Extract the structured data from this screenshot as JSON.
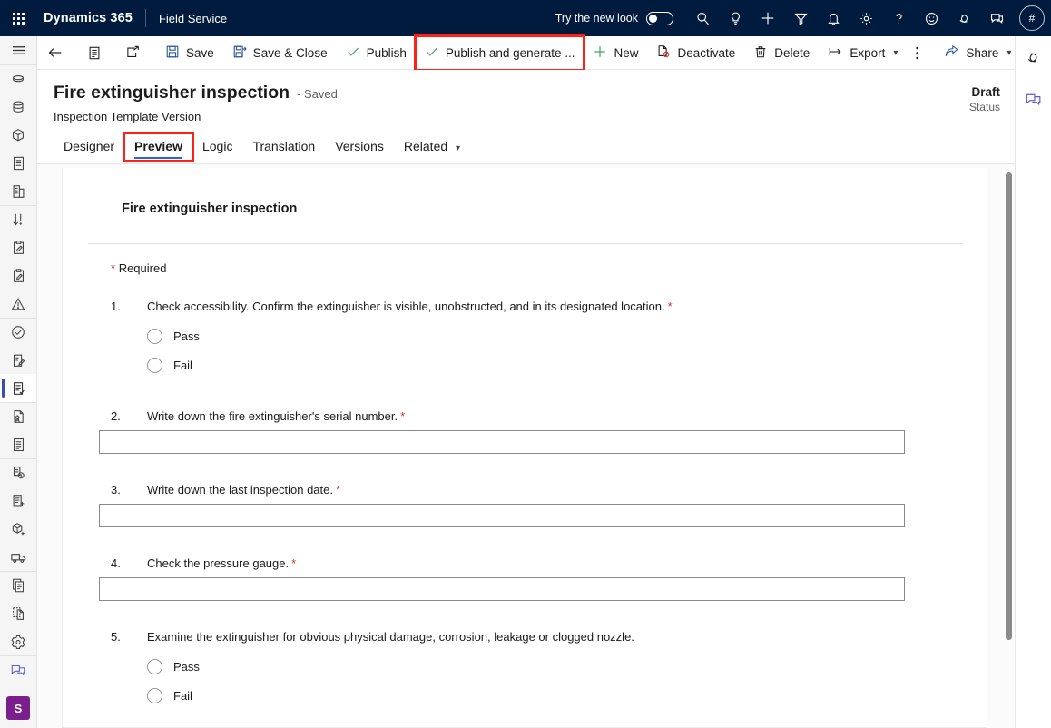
{
  "suite": {
    "waffle_label": "app-launcher",
    "brand": "Dynamics 365",
    "app_name": "Field Service",
    "new_look_label": "Try the new look",
    "new_look_on": false,
    "icons": [
      {
        "name": "search-icon",
        "label": "Search"
      },
      {
        "name": "lightbulb-icon",
        "label": "Insights"
      },
      {
        "name": "plus-icon",
        "label": "Quick create"
      },
      {
        "name": "filter-icon",
        "label": "Filter"
      },
      {
        "name": "bell-icon",
        "label": "Notifications"
      },
      {
        "name": "gear-icon",
        "label": "Settings"
      },
      {
        "name": "question-icon",
        "label": "Help"
      },
      {
        "name": "smiley-icon",
        "label": "Feedback"
      },
      {
        "name": "copilot-icon",
        "label": "Copilot"
      },
      {
        "name": "chat-icon",
        "label": "Teams chat"
      }
    ],
    "avatar_text": "#"
  },
  "command_bar": {
    "back_label": "Back",
    "form_selector_label": "Form selector",
    "popout_label": "Open in new window",
    "items": [
      {
        "name": "save-button",
        "label": "Save",
        "icon": "save-icon",
        "highlight": false
      },
      {
        "name": "save-and-close-button",
        "label": "Save & Close",
        "icon": "save-close-icon",
        "highlight": false
      },
      {
        "name": "publish-button",
        "label": "Publish",
        "icon": "check-icon",
        "highlight": false
      },
      {
        "name": "publish-and-generate-button",
        "label": "Publish and generate ...",
        "icon": "check-icon",
        "highlight": true
      },
      {
        "name": "new-button",
        "label": "New",
        "icon": "plus-icon",
        "highlight": false
      },
      {
        "name": "deactivate-button",
        "label": "Deactivate",
        "icon": "deactivate-icon",
        "highlight": false
      },
      {
        "name": "delete-button",
        "label": "Delete",
        "icon": "trash-icon",
        "highlight": false
      },
      {
        "name": "export-button",
        "label": "Export",
        "icon": "export-icon",
        "highlight": false,
        "chevron": true
      }
    ],
    "overflow_label": "More commands",
    "share_label": "Share",
    "highlight_color": "#ff2116"
  },
  "record": {
    "title": "Fire extinguisher inspection",
    "saved_text": "- Saved",
    "subtitle": "Inspection Template Version",
    "status_value": "Draft",
    "status_label": "Status",
    "tabs": [
      {
        "name": "tab-designer",
        "label": "Designer",
        "active": false,
        "highlight": false,
        "chevron": false
      },
      {
        "name": "tab-preview",
        "label": "Preview",
        "active": true,
        "highlight": true,
        "chevron": false
      },
      {
        "name": "tab-logic",
        "label": "Logic",
        "active": false,
        "highlight": false,
        "chevron": false
      },
      {
        "name": "tab-translation",
        "label": "Translation",
        "active": false,
        "highlight": false,
        "chevron": false
      },
      {
        "name": "tab-versions",
        "label": "Versions",
        "active": false,
        "highlight": false,
        "chevron": false
      },
      {
        "name": "tab-related",
        "label": "Related",
        "active": false,
        "highlight": false,
        "chevron": true
      }
    ],
    "active_tab_underline_color": "#2266e3"
  },
  "form": {
    "title": "Fire extinguisher inspection",
    "required_note": "Required",
    "required_star": "*",
    "questions": [
      {
        "number": "1.",
        "text": "Check accessibility. Confirm the extinguisher is visible, unobstructed, and in its designated location.",
        "required": true,
        "type": "radio",
        "options": [
          "Pass",
          "Fail"
        ],
        "value": ""
      },
      {
        "number": "2.",
        "text": "Write down the fire extinguisher's serial number.",
        "required": true,
        "type": "text",
        "value": ""
      },
      {
        "number": "3.",
        "text": "Write down the last inspection date.",
        "required": true,
        "type": "text",
        "value": ""
      },
      {
        "number": "4.",
        "text": "Check the pressure gauge.",
        "required": true,
        "type": "text",
        "value": ""
      },
      {
        "number": "5.",
        "text": "Examine the extinguisher for obvious physical damage, corrosion, leakage or clogged nozzle.",
        "required": false,
        "type": "radio",
        "options": [
          "Pass",
          "Fail"
        ],
        "value": ""
      }
    ]
  },
  "left_rail": {
    "items": [
      {
        "name": "site-map-hamburger-icon",
        "group": 0,
        "active": false
      },
      {
        "name": "recent-icon",
        "group": 0,
        "active": false
      },
      {
        "name": "database-icon",
        "group": 0,
        "active": false
      },
      {
        "name": "cube-icon",
        "group": 0,
        "active": false
      },
      {
        "name": "document-list-icon",
        "group": 0,
        "active": false
      },
      {
        "name": "building-document-icon",
        "group": 0,
        "active": false
      },
      {
        "name": "sort-down-icon",
        "group": 1,
        "active": false
      },
      {
        "name": "clipboard-edit-icon",
        "group": 1,
        "active": false
      },
      {
        "name": "clipboard-edit-alt-icon",
        "group": 1,
        "active": false
      },
      {
        "name": "warning-triangle-icon",
        "group": 1,
        "active": false
      },
      {
        "name": "check-circle-icon",
        "group": 1,
        "active": false
      },
      {
        "name": "clipboard-pen-icon",
        "group": 1,
        "active": false
      },
      {
        "name": "inspection-template-icon",
        "group": 1,
        "active": true
      },
      {
        "name": "certificate-document-icon",
        "group": 2,
        "active": false
      },
      {
        "name": "document-lines-icon",
        "group": 2,
        "active": false
      },
      {
        "name": "document-clock-icon",
        "group": 3,
        "active": false
      },
      {
        "name": "document-add-icon",
        "group": 4,
        "active": false
      },
      {
        "name": "package-add-icon",
        "group": 4,
        "active": false
      },
      {
        "name": "truck-icon",
        "group": 4,
        "active": false
      },
      {
        "name": "copy-document-icon",
        "group": 5,
        "active": false
      },
      {
        "name": "dashed-document-icon",
        "group": 5,
        "active": false
      },
      {
        "name": "gear-icon",
        "group": 5,
        "active": false
      },
      {
        "name": "chat-icon",
        "group": 6,
        "active": false
      }
    ],
    "user_initial": "S",
    "user_color": "#7b1f8e"
  },
  "right_rail": {
    "items": [
      {
        "name": "copilot-icon"
      },
      {
        "name": "chat-icon"
      }
    ]
  },
  "scrollbar": {
    "name": "content-vertical-scrollbar",
    "thumb_top_pct": 2,
    "thumb_height_pct": 83
  }
}
